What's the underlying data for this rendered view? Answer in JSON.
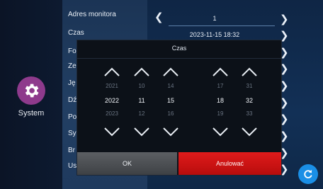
{
  "sidebar": {
    "system_label": "System",
    "system_icon": "gear-icon",
    "icon_color": "#8e3a8c"
  },
  "menu": {
    "items": [
      "Adres monitora",
      "Czas",
      "Fo",
      "Ze",
      "Ję",
      "Dź",
      "Po",
      "Sy",
      "Br",
      "Us"
    ]
  },
  "settings": {
    "monitor_address_value": "1",
    "time_value": "2023-11-15 18:32"
  },
  "dialog": {
    "title": "Czas",
    "columns": [
      {
        "prev": "2021",
        "selected": "2022",
        "next": "2023"
      },
      {
        "prev": "10",
        "selected": "11",
        "next": "12"
      },
      {
        "prev": "14",
        "selected": "15",
        "next": "16"
      },
      {
        "prev": "17",
        "selected": "18",
        "next": "19"
      },
      {
        "prev": "31",
        "selected": "32",
        "next": "33"
      }
    ],
    "ok_label": "OK",
    "cancel_label": "Anulować"
  },
  "colors": {
    "cancel_button": "#d41313",
    "fab": "#1a8fe6"
  },
  "fab_icon": "refresh-icon"
}
